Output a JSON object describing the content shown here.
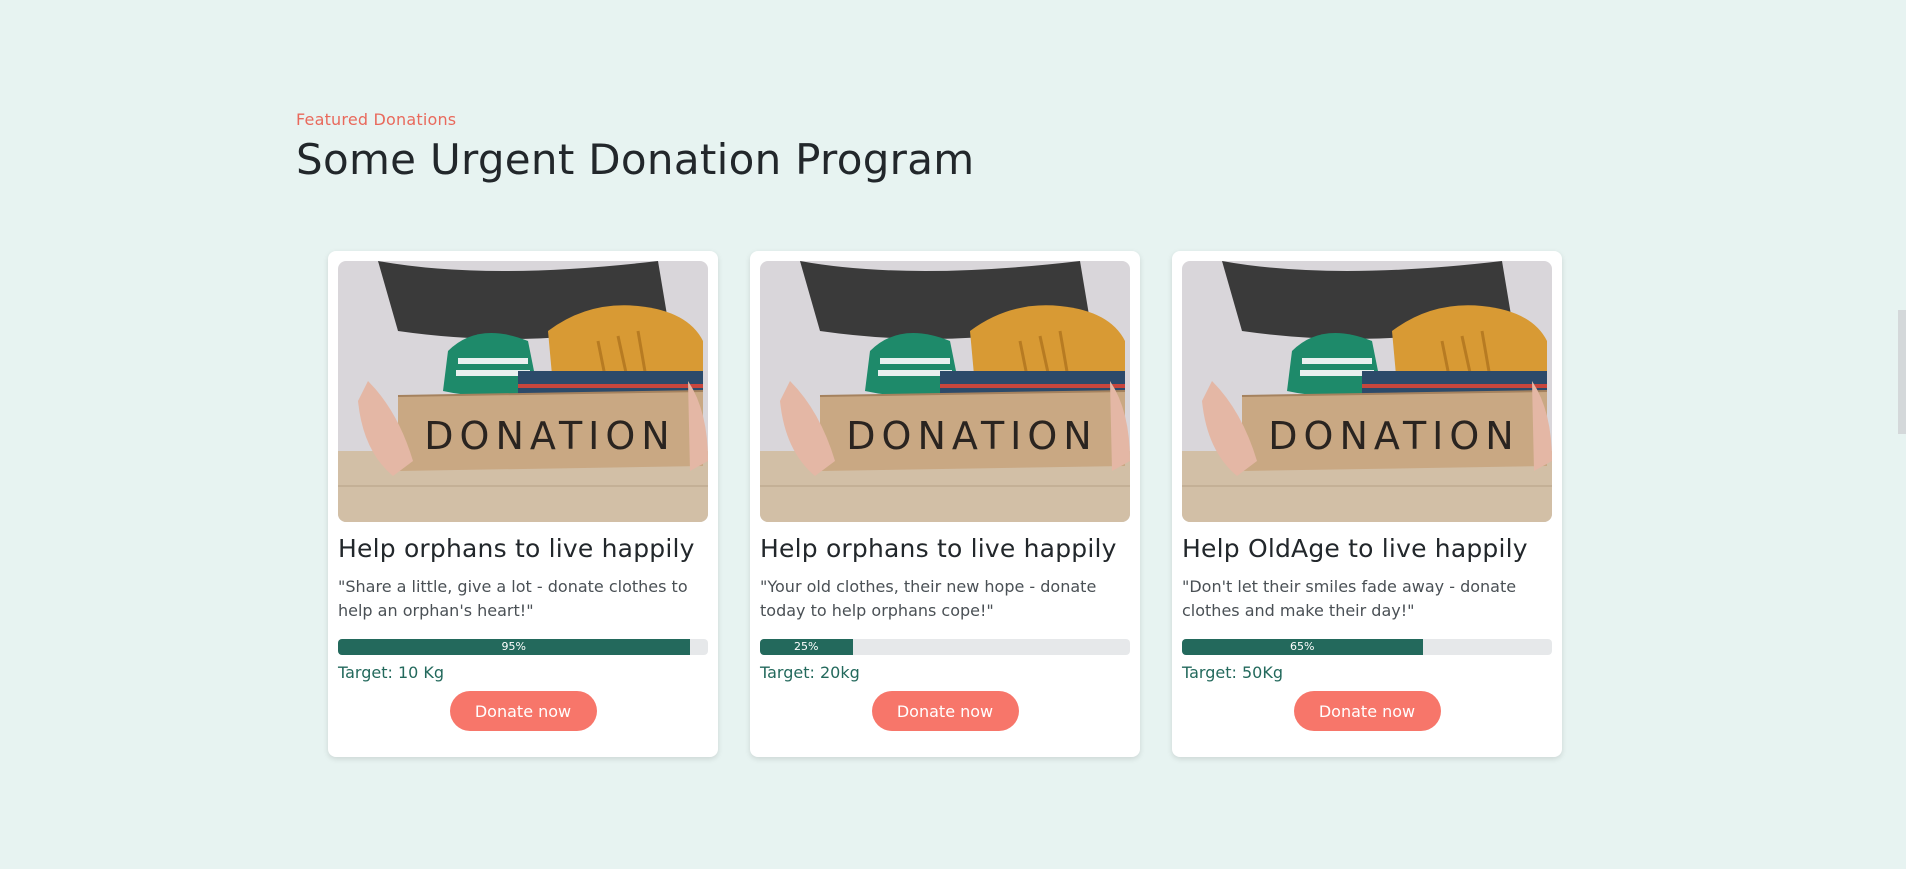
{
  "section": {
    "eyebrow": "Featured Donations",
    "title": "Some Urgent Donation Program"
  },
  "image": {
    "box_text": "DONATION"
  },
  "cards": [
    {
      "title": "Help orphans to live happily",
      "description": "\"Share a little, give a lot - donate clothes to help an orphan's heart!\"",
      "progress": 95,
      "progress_label": "95%",
      "target": "Target: 10 Kg",
      "button": "Donate now"
    },
    {
      "title": "Help orphans to live happily",
      "description": "\"Your old clothes, their new hope - donate today to help orphans cope!\"",
      "progress": 25,
      "progress_label": "25%",
      "target": "Target: 20kg",
      "button": "Donate now"
    },
    {
      "title": "Help OldAge to live happily",
      "description": "\"Don't let their smiles fade away - donate clothes and make their day!\"",
      "progress": 65,
      "progress_label": "65%",
      "target": "Target: 50Kg",
      "button": "Donate now"
    }
  ],
  "colors": {
    "background": "#e7f3f1",
    "accent": "#f7766a",
    "eyebrow": "#e9695c",
    "progress": "#23695c",
    "track": "#e6e8ea"
  },
  "icons": {
    "card_image": "donation-box-photo"
  }
}
